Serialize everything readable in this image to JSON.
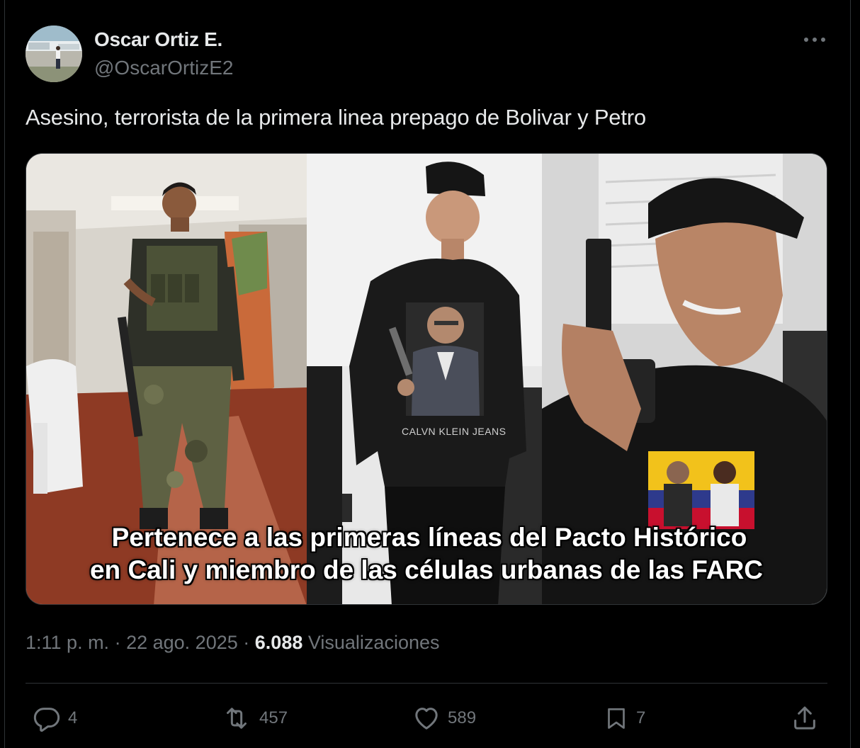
{
  "author": {
    "name": "Oscar Ortiz E.",
    "handle": "@OscarOrtizE2"
  },
  "tweet": {
    "text": "Asesino, terrorista de la primera linea prepago de Bolivar y Petro"
  },
  "media": {
    "caption_line_1": "Pertenece a las primeras líneas del Pacto Histórico",
    "caption_line_2": "en Cali y miembro  de las células urbanas de las FARC",
    "shirt_text": "CALVN KLEIN JEANS"
  },
  "meta": {
    "time": "1:11 p. m.",
    "separator": "·",
    "date": "22 ago. 2025",
    "views_count": "6.088",
    "views_label": "Visualizaciones"
  },
  "actions": {
    "replies": "4",
    "reposts": "457",
    "likes": "589",
    "bookmarks": "7"
  },
  "icons": {
    "more": "more-icon",
    "reply": "reply-icon",
    "retweet": "retweet-icon",
    "like": "heart-icon",
    "bookmark": "bookmark-icon",
    "share": "share-icon"
  },
  "colors": {
    "background": "#000000",
    "text_primary": "#e7e9ea",
    "text_secondary": "#71767b",
    "border": "#2f3336"
  }
}
